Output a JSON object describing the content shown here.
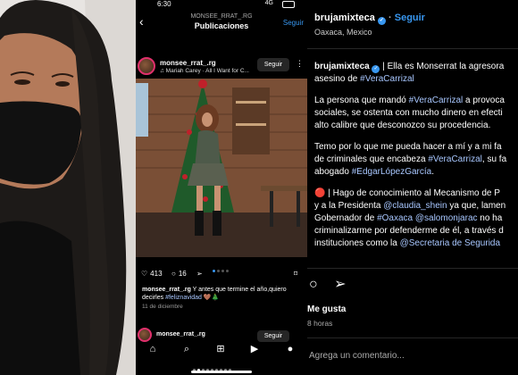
{
  "left_photo": {
    "description_icon": "person-photo"
  },
  "phone": {
    "status": {
      "time": "6:30",
      "network": "4G"
    },
    "header": {
      "username": "MONSEE_RRAT_.RG",
      "title": "Publicaciones",
      "follow": "Seguir"
    },
    "post": {
      "username": "monsee_rrat_.rg",
      "music": "♫ Mariah Carey · All I Want for C...",
      "follow": "Seguir",
      "likes": "413",
      "comments": "16",
      "caption_user": "monsee_rrat_.rg",
      "caption_text": " Y antes que termine el año,quiero decirles ",
      "caption_tag": "#feliznavidad",
      "caption_emoji": " 🤎🎄",
      "date": "11 de diciembre"
    },
    "post2": {
      "username": "monsee_rrat_.rg",
      "follow": "Seguir"
    }
  },
  "desktop": {
    "header": {
      "username": "brujamixteca",
      "follow": "Seguir",
      "location": "Oaxaca, Mexico"
    },
    "caption": {
      "username": "brujamixteca",
      "line1_rest": " | Ella es Monserrat la agresora",
      "line2_pre": "asesino de ",
      "line2_tag": "#VeraCarrizal",
      "p2_line1_pre": "La persona que mandó ",
      "p2_line1_tag": "#VeraCarrizal",
      "p2_line1_post": " a provoca",
      "p2_line2": "sociales, se ostenta con mucho dinero en efecti",
      "p2_line3": "alto calibre que desconozco su procedencia.",
      "p3_line1": "Temo por lo que me pueda hacer a mí y a mi fa",
      "p3_line2_pre": "de criminales que encabeza ",
      "p3_line2_tag": "#VeraCarrizal",
      "p3_line2_post": ", su fa",
      "p3_line3_pre": "abogado ",
      "p3_line3_tag": "#EdgarLópezGarcía",
      "p3_line3_post": ".",
      "p4_line1": "🔴 | Hago de conocimiento al Mecanismo de P",
      "p4_line2_pre": "y a la Presidenta ",
      "p4_line2_tag": "@claudia_shein",
      "p4_line2_post": " ya que, lamen",
      "p4_line3_pre": "Gobernador de ",
      "p4_line3_tag1": "#Oaxaca",
      "p4_line3_mid": " ",
      "p4_line3_tag2": "@salomonjarac",
      "p4_line3_post": " no ha",
      "p4_line4": "criminalizarme por defenderme de él, a través d",
      "p4_line5_pre": "instituciones como la ",
      "p4_line5_tag": "@Secretaria de Segurida"
    },
    "likes_label": "Me gusta",
    "time_ago": "8 horas",
    "comment_placeholder": "Agrega un comentario..."
  }
}
